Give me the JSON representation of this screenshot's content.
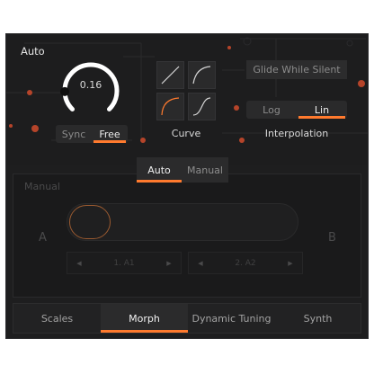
{
  "panel": {
    "title": "Auto"
  },
  "glide": {
    "value": "0.16",
    "fraction": 0.16,
    "sync_label": "Sync",
    "free_label": "Free",
    "selected": "Free"
  },
  "curve": {
    "label": "Curve",
    "options": [
      "linear",
      "ease-in",
      "ease-out",
      "s-curve"
    ],
    "selected": "ease-out"
  },
  "glide_while_silent": {
    "label": "Glide While Silent"
  },
  "interpolation": {
    "label": "Interpolation",
    "log_label": "Log",
    "lin_label": "Lin",
    "selected": "Lin"
  },
  "mode_tabs": {
    "auto_label": "Auto",
    "manual_label": "Manual",
    "selected": "Auto"
  },
  "manual": {
    "title": "Manual",
    "a_label": "A",
    "b_label": "B",
    "slot_a": {
      "label": "1. A1"
    },
    "slot_b": {
      "label": "2. A2"
    },
    "arrow_left": "◀",
    "arrow_right": "▶"
  },
  "bottom_tabs": {
    "items": [
      "Scales",
      "Morph",
      "Dynamic Tuning",
      "Synth"
    ],
    "selected": "Morph"
  },
  "colors": {
    "accent": "#ff7a2e",
    "background": "#1e1e1f",
    "control": "#2a2a2b",
    "text": "#e4e4e4",
    "dim_text": "#8b8b8b"
  }
}
